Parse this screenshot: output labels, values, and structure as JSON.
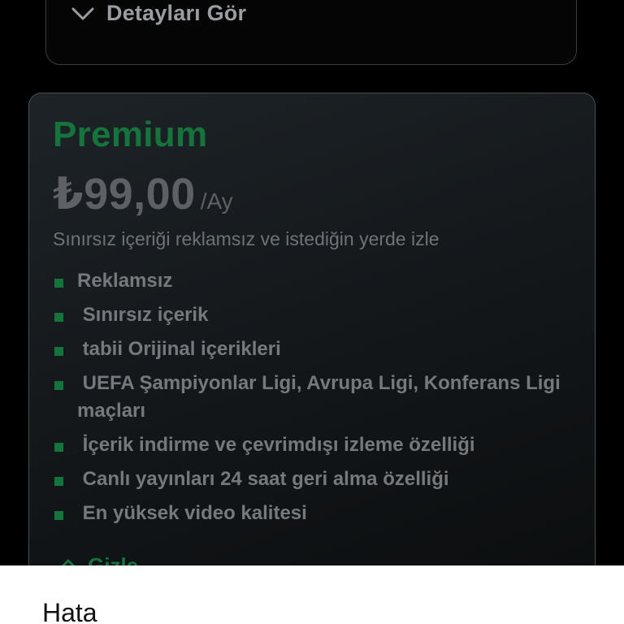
{
  "top_card": {
    "details_label": "Detayları Gör",
    "toggle_icon": "chevron-down-icon"
  },
  "premium": {
    "name": "Premium",
    "price": "₺99,00",
    "period": "/Ay",
    "tagline": "Sınırsız içeriği reklamsız ve istediğin yerde izle",
    "features": [
      "Reklamsız",
      " Sınırsız içerik",
      " tabii Orijinal içerikleri",
      " UEFA Şampiyonlar Ligi, Avrupa Ligi, Konferans Ligi maçları",
      " İçerik indirme ve çevrimdışı izleme özelliği",
      " Canlı yayınları 24 saat geri alma özelliği",
      " En yüksek video kalitesi"
    ],
    "hide_label": "Gizle",
    "hide_icon": "chevron-up-icon"
  },
  "dialog": {
    "title": "Hata"
  },
  "colors": {
    "accent": "#14743c",
    "background": "#000000",
    "muted_text": "#75797e",
    "sheet": "#ffffff"
  }
}
